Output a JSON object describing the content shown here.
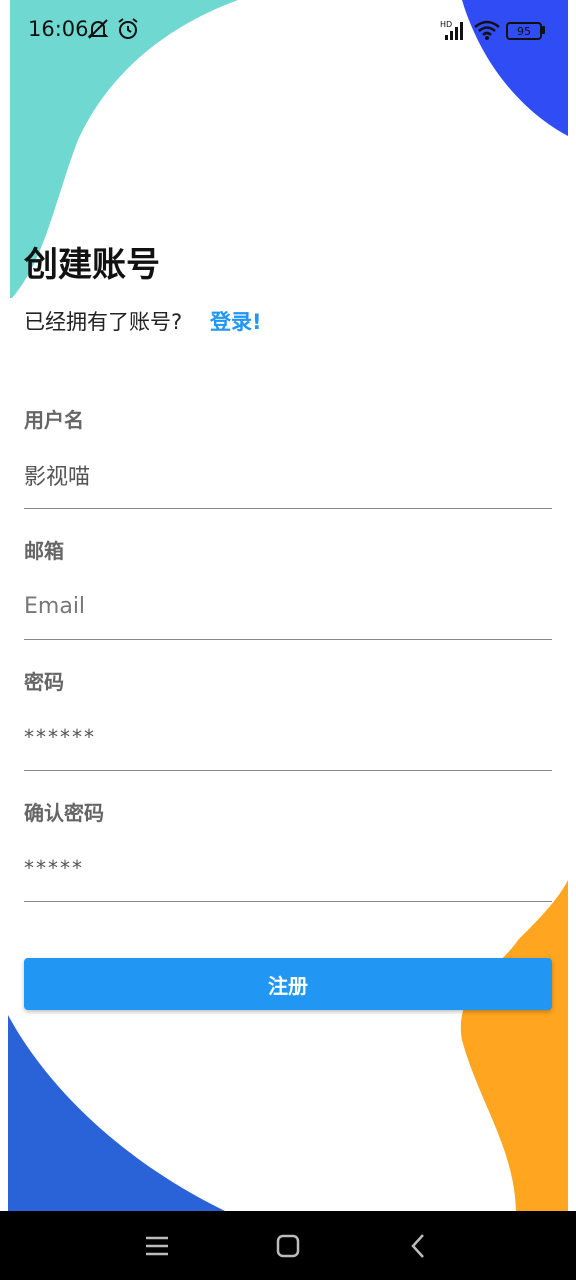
{
  "status_bar": {
    "time": "16:06",
    "battery": "95",
    "icons": [
      "mute-icon",
      "alarm-icon",
      "hd-signal-icon",
      "wifi-icon",
      "battery-icon"
    ]
  },
  "header": {
    "title": "创建账号",
    "subtitle": "已经拥有了账号?",
    "login_link": "登录!"
  },
  "form": {
    "username": {
      "label": "用户名",
      "value": "影视喵"
    },
    "email": {
      "label": "邮箱",
      "placeholder": "Email"
    },
    "password": {
      "label": "密码",
      "value": "******"
    },
    "confirm_password": {
      "label": "确认密码",
      "value": "*****"
    },
    "submit_label": "注册"
  },
  "nav_bar": {
    "buttons": [
      "menu-icon",
      "home-icon",
      "back-icon"
    ]
  },
  "colors": {
    "accent": "#2196F3",
    "teal_blob": "#6FD8D0",
    "blue_blob": "#2F4CF5",
    "dark_blue_blob": "#2A62D8",
    "orange_blob": "#FFA51F"
  }
}
